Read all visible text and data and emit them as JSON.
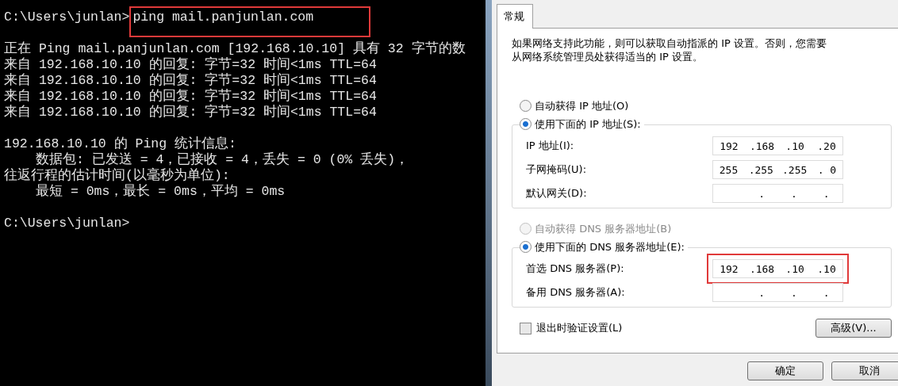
{
  "console": {
    "prompt": "C:\\Users\\junlan>",
    "command": {
      "text": "ping mail.panjunlan.com",
      "highlighted": true
    },
    "blocks": [
      [
        {
          "text": "正在 Ping mail.panjunlan.com [192.168.10.10] 具有 32 字节的数",
          "indented": false
        },
        {
          "text": "来自 192.168.10.10 的回复: 字节=32 时间<1ms TTL=64",
          "indented": false
        },
        {
          "text": "来自 192.168.10.10 的回复: 字节=32 时间<1ms TTL=64",
          "indented": false
        },
        {
          "text": "来自 192.168.10.10 的回复: 字节=32 时间<1ms TTL=64",
          "indented": false
        },
        {
          "text": "来自 192.168.10.10 的回复: 字节=32 时间<1ms TTL=64",
          "indented": false
        }
      ],
      [
        {
          "text": "192.168.10.10 的 Ping 统计信息:",
          "indented": false
        },
        {
          "text": "数据包: 已发送 = 4，已接收 = 4，丢失 = 0 (0% 丢失)，",
          "indented": true
        },
        {
          "text": "往返行程的估计时间(以毫秒为单位):",
          "indented": false
        },
        {
          "text": "最短 = 0ms，最长 = 0ms，平均 = 0ms",
          "indented": true
        }
      ],
      [
        {
          "text": "C:\\Users\\junlan>",
          "indented": false
        }
      ]
    ]
  },
  "dialog": {
    "tabs": [
      {
        "label": "常规",
        "selected": true
      }
    ],
    "description": "如果网络支持此功能，则可以获取自动指派的 IP 设置。否则，您需要从网络系统管理员处获得适当的 IP 设置。",
    "groups": [
      {
        "auto_option": {
          "label": "自动获得 IP 地址(O)",
          "selected": false,
          "disabled": false
        },
        "manual_option": {
          "label": "使用下面的 IP 地址(S):",
          "selected": true,
          "disabled": false
        },
        "fields": [
          {
            "label": "IP 地址(I):",
            "octets": [
              "192",
              ".168",
              ".10",
              ".20"
            ],
            "highlighted": false
          },
          {
            "label": "子网掩码(U):",
            "octets": [
              "255",
              ".255",
              ".255",
              ". 0"
            ],
            "highlighted": false
          },
          {
            "label": "默认网关(D):",
            "separators": [
              ".",
              ".",
              "."
            ],
            "highlighted": false
          }
        ]
      },
      {
        "auto_option": {
          "label": "自动获得 DNS 服务器地址(B)",
          "selected": false,
          "disabled": true
        },
        "manual_option": {
          "label": "使用下面的 DNS 服务器地址(E):",
          "selected": true,
          "disabled": false
        },
        "fields": [
          {
            "label": "首选 DNS 服务器(P):",
            "octets": [
              "192",
              ".168",
              ".10",
              ".10"
            ],
            "highlighted": true
          },
          {
            "label": "备用 DNS 服务器(A):",
            "separators": [
              ".",
              ".",
              "."
            ],
            "highlighted": false
          }
        ]
      }
    ],
    "validate_checkbox": {
      "label": "退出时验证设置(L)",
      "checked": false
    },
    "advanced_button": "高级(V)...",
    "buttons": [
      "确定",
      "取消"
    ]
  }
}
